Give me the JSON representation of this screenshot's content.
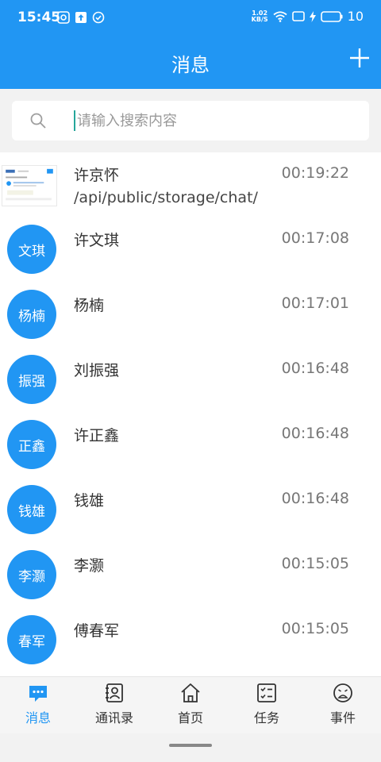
{
  "status_bar": {
    "time": "15:45",
    "net_speed_value": "1.02",
    "net_speed_unit": "KB/S",
    "battery": "10"
  },
  "header": {
    "title": "消息"
  },
  "search": {
    "placeholder": "请输入搜索内容"
  },
  "messages": [
    {
      "name": "许京怀",
      "preview": "/api/public/storage/chat/",
      "time": "00:19:22",
      "avatar_text": ""
    },
    {
      "name": "许文琪",
      "preview": "",
      "time": "00:17:08",
      "avatar_text": "文琪"
    },
    {
      "name": "杨楠",
      "preview": "",
      "time": "00:17:01",
      "avatar_text": "杨楠"
    },
    {
      "name": "刘振强",
      "preview": "",
      "time": "00:16:48",
      "avatar_text": "振强"
    },
    {
      "name": "许正鑫",
      "preview": "",
      "time": "00:16:48",
      "avatar_text": "正鑫"
    },
    {
      "name": "钱雄",
      "preview": "",
      "time": "00:16:48",
      "avatar_text": "钱雄"
    },
    {
      "name": "李灏",
      "preview": "",
      "time": "00:15:05",
      "avatar_text": "李灏"
    },
    {
      "name": "傅春军",
      "preview": "",
      "time": "00:15:05",
      "avatar_text": "春军"
    }
  ],
  "tabs": [
    {
      "label": "消息",
      "icon": "chat-icon",
      "active": true
    },
    {
      "label": "通讯录",
      "icon": "contacts-icon",
      "active": false
    },
    {
      "label": "首页",
      "icon": "home-icon",
      "active": false
    },
    {
      "label": "任务",
      "icon": "task-icon",
      "active": false
    },
    {
      "label": "事件",
      "icon": "event-icon",
      "active": false
    }
  ],
  "colors": {
    "primary": "#2196f3",
    "tab_inactive": "#333333"
  }
}
